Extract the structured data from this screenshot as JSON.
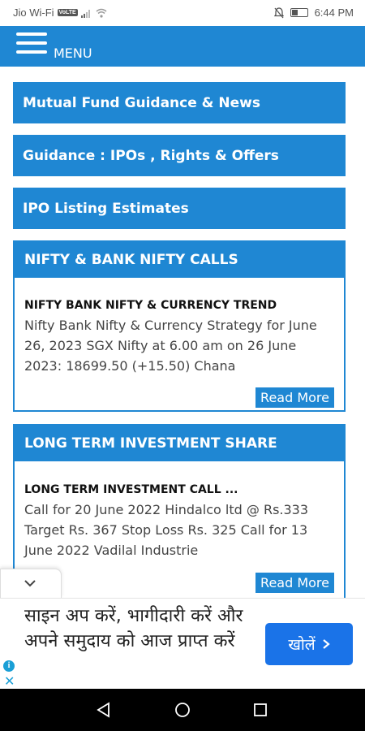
{
  "status_bar": {
    "carrier": "Jio Wi-Fi",
    "network_badge": "VoLTE",
    "time": "6:44 PM"
  },
  "menu": {
    "label": "MENU"
  },
  "nav_links": [
    {
      "label": "Mutual Fund Guidance & News"
    },
    {
      "label": "Guidance : IPOs , Rights & Offers"
    },
    {
      "label": "IPO Listing Estimates"
    }
  ],
  "cards": [
    {
      "header": "NIFTY & BANK NIFTY CALLS",
      "title": "NIFTY BANK NIFTY & CURRENCY TREND",
      "excerpt": "Nifty Bank Nifty & Currency Strategy for June 26, 2023 SGX Nifty at 6.00 am on 26 June 2023: 18699.50 (+15.50) Chana",
      "read_more": "Read More"
    },
    {
      "header": "LONG TERM INVESTMENT SHARE",
      "title": "LONG TERM INVESTMENT CALL ...",
      "excerpt": "Call for 20 June 2022 Hindalco ltd  @ Rs.333 Target Rs. 367 Stop Loss Rs. 325 Call for 13 June 2022 Vadilal Industrie",
      "read_more": "Read More"
    }
  ],
  "ad": {
    "text": "साइन अप करें, भागीदारी करें और अपने समुदाय को आज प्राप्त करें",
    "cta": "खोलें",
    "info_icon": "info-icon",
    "close_icon": "close-icon"
  },
  "colors": {
    "primary": "#1f87d3",
    "cta": "#1a73e8"
  }
}
